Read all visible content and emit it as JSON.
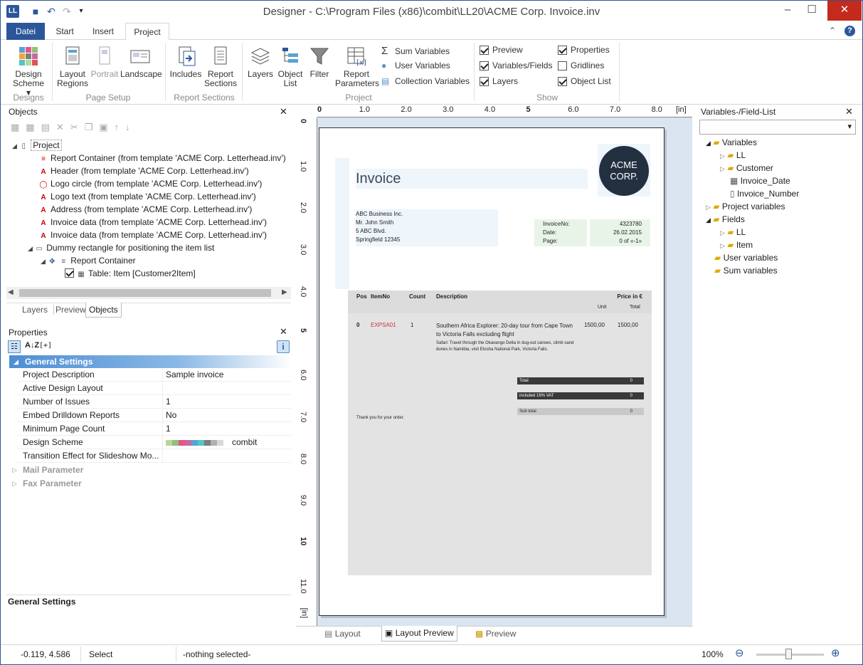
{
  "window": {
    "title": "Designer - C:\\Program Files (x86)\\combit\\LL20\\ACME Corp. Invoice.inv",
    "app_icon": "LL"
  },
  "tabs": [
    {
      "label": "Datei"
    },
    {
      "label": "Start"
    },
    {
      "label": "Insert"
    },
    {
      "label": "Project"
    }
  ],
  "ribbon": {
    "design_scheme": "Design\nScheme",
    "layout_regions": "Layout\nRegions",
    "portrait": "Portrait",
    "landscape": "Landscape",
    "includes": "Includes",
    "report_sections": "Report\nSections",
    "layers": "Layers",
    "object_list": "Object\nList",
    "filter": "Filter",
    "report_parameters": "Report\nParameters",
    "sum_variables": "Sum Variables",
    "user_variables": "User Variables",
    "collection_variables": "Collection Variables",
    "preview": "Preview",
    "variables_fields": "Variables/Fields",
    "layers_cb": "Layers",
    "properties": "Properties",
    "gridlines": "Gridlines",
    "object_list_cb": "Object List",
    "groups": {
      "designs": "Designs",
      "page_setup": "Page Setup",
      "report_sections": "Report Sections",
      "project": "Project",
      "show": "Show"
    }
  },
  "objects": {
    "title": "Objects",
    "tree": [
      {
        "label": "Project"
      },
      {
        "label": "Report Container (from template 'ACME Corp. Letterhead.inv')"
      },
      {
        "label": "Header (from template 'ACME Corp. Letterhead.inv')"
      },
      {
        "label": "Logo circle (from template 'ACME Corp. Letterhead.inv')"
      },
      {
        "label": "Logo text (from template 'ACME Corp. Letterhead.inv')"
      },
      {
        "label": "Address (from template 'ACME Corp. Letterhead.inv')"
      },
      {
        "label": "Invoice data (from template 'ACME Corp. Letterhead.inv')"
      },
      {
        "label": "Invoice data (from template 'ACME Corp. Letterhead.inv')"
      },
      {
        "label": "Dummy rectangle for positioning the item list"
      },
      {
        "label": "Report Container"
      },
      {
        "label": "Table: Item [Customer2Item]"
      }
    ],
    "bottom_tabs": [
      "Layers",
      "Preview",
      "Objects"
    ]
  },
  "properties": {
    "title": "Properties",
    "section": "General Settings",
    "rows": [
      {
        "key": "Project Description",
        "value": "Sample invoice"
      },
      {
        "key": "Active Design Layout",
        "value": ""
      },
      {
        "key": "Number of Issues",
        "value": "1"
      },
      {
        "key": "Embed Drilldown Reports",
        "value": "No"
      },
      {
        "key": "Minimum Page Count",
        "value": "1"
      },
      {
        "key": "Design Scheme",
        "value": "combit"
      },
      {
        "key": "Transition Effect for Slideshow Mo...",
        "value": ""
      }
    ],
    "collapsed": [
      "Mail Parameter",
      "Fax Parameter"
    ],
    "description_title": "General Settings",
    "scheme_colors": [
      "#b9d69a",
      "#8fc07c",
      "#e5548a",
      "#c76a9b",
      "#5aa2d4",
      "#56c3c8",
      "#7d7d7d",
      "#b0b0b0",
      "#d8d8d8"
    ]
  },
  "ruler": {
    "top": [
      "0",
      "1.0",
      "2.0",
      "3.0",
      "4.0",
      "5",
      "6.0",
      "7.0",
      "8.0"
    ],
    "left": [
      "0",
      "1.0",
      "2.0",
      "3.0",
      "4.0",
      "5",
      "6.0",
      "7.0",
      "8.0",
      "9.0",
      "10",
      "11.0"
    ],
    "unit": "[in]"
  },
  "invoice": {
    "heading": "Invoice",
    "logo": "ACME\nCORP.",
    "address": [
      "ABC Business Inc.",
      "Mr. John Smith",
      "5 ABC Blvd.",
      "Springfield 12345"
    ],
    "meta_labels": [
      "InvoiceNo:",
      "Date:",
      "Page:"
    ],
    "meta_values": [
      "4323780",
      "26.02.2015",
      "0 of «-1»"
    ],
    "table_head": {
      "pos": "Pos",
      "itemno": "ItemNo",
      "count": "Count",
      "desc": "Description",
      "price": "Price in €",
      "unit": "Unit",
      "total": "Total"
    },
    "row": {
      "pos": "0",
      "itemno": "EXPSA01",
      "count": "1",
      "desc": "Southern Africa Explorer: 20-day tour from Cape Town to Victoria Falls excluding flight",
      "sub": "Safari: Travel through the Okavango Delta in dug-out canoes, climb sand dunes in Namibia, visit Etosha National Park, Victoria Falls.",
      "unit": "1500,00",
      "total": "1500,00"
    },
    "totals": [
      {
        "label": "Total",
        "value": "0"
      },
      {
        "label": "included 19% VAT",
        "value": "0"
      },
      {
        "label": "Sub total",
        "value": "0"
      }
    ],
    "thanks": "Thank you for your order."
  },
  "center_tabs": [
    "Layout",
    "Layout Preview",
    "Preview"
  ],
  "varlist": {
    "title": "Variables-/Field-List",
    "tree": [
      {
        "label": "Variables"
      },
      {
        "label": "LL"
      },
      {
        "label": "Customer"
      },
      {
        "label": "Invoice_Date"
      },
      {
        "label": "Invoice_Number"
      },
      {
        "label": "Project variables"
      },
      {
        "label": "Fields"
      },
      {
        "label": "LL"
      },
      {
        "label": "Item"
      },
      {
        "label": "User variables"
      },
      {
        "label": "Sum variables"
      }
    ]
  },
  "status": {
    "coords": "-0.119, 4.586",
    "mode": "Select",
    "selection": "-nothing selected-",
    "zoom": "100%"
  }
}
